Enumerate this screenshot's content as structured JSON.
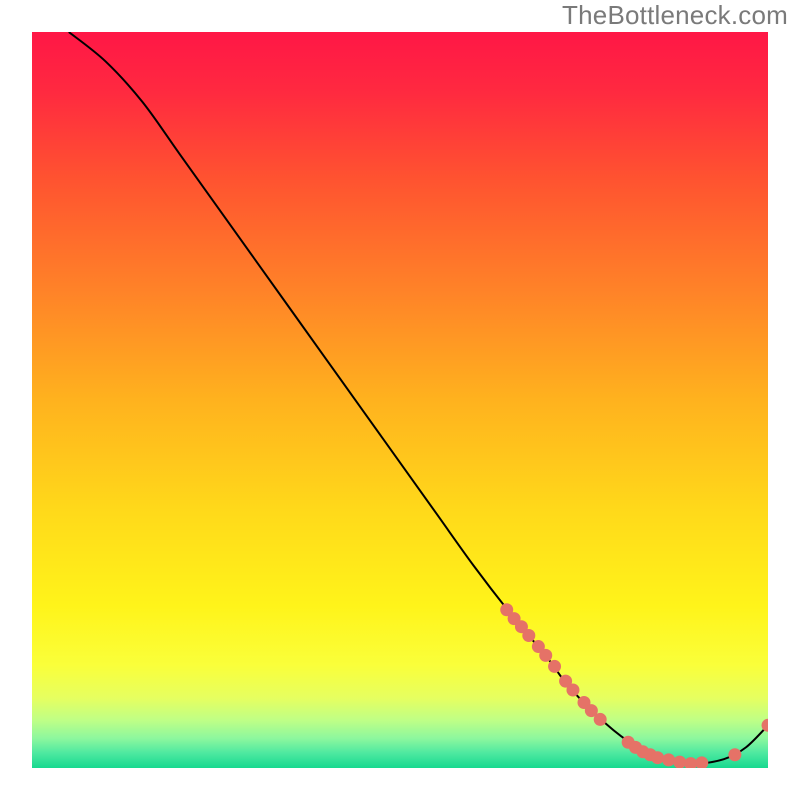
{
  "watermark": "TheBottleneck.com",
  "chart_data": {
    "type": "line",
    "title": "",
    "xlabel": "",
    "ylabel": "",
    "xlim": [
      0,
      100
    ],
    "ylim": [
      0,
      100
    ],
    "grid": false,
    "legend": false,
    "gradient_stops": [
      {
        "offset": 0.0,
        "color": "#ff1746"
      },
      {
        "offset": 0.08,
        "color": "#ff2940"
      },
      {
        "offset": 0.2,
        "color": "#ff5330"
      },
      {
        "offset": 0.35,
        "color": "#ff8228"
      },
      {
        "offset": 0.5,
        "color": "#ffb21e"
      },
      {
        "offset": 0.65,
        "color": "#ffd91a"
      },
      {
        "offset": 0.78,
        "color": "#fff41a"
      },
      {
        "offset": 0.86,
        "color": "#faff3a"
      },
      {
        "offset": 0.905,
        "color": "#e6ff60"
      },
      {
        "offset": 0.935,
        "color": "#bfff86"
      },
      {
        "offset": 0.96,
        "color": "#8cf79e"
      },
      {
        "offset": 0.98,
        "color": "#4de8a0"
      },
      {
        "offset": 1.0,
        "color": "#17d98f"
      }
    ],
    "curve": {
      "comment": "Main black curve; y is approximate distance-from-optimal metric (100=worst, 0=best)",
      "x": [
        5,
        10,
        15,
        20,
        25,
        30,
        35,
        40,
        45,
        50,
        55,
        60,
        65,
        70,
        73,
        78,
        82,
        86,
        90,
        94,
        97,
        100
      ],
      "y": [
        100,
        96,
        90.5,
        83.5,
        76.5,
        69.5,
        62.5,
        55.5,
        48.5,
        41.5,
        34.5,
        27.5,
        21.0,
        15.0,
        11.0,
        6.0,
        3.0,
        1.2,
        0.6,
        1.2,
        2.8,
        5.8
      ]
    },
    "markers": {
      "comment": "Salmon dots overlaid on the curve (right-hand cluster)",
      "color": "#e57267",
      "points": [
        {
          "x": 64.5,
          "y": 21.5
        },
        {
          "x": 65.5,
          "y": 20.3
        },
        {
          "x": 66.5,
          "y": 19.2
        },
        {
          "x": 67.5,
          "y": 18.0
        },
        {
          "x": 68.8,
          "y": 16.5
        },
        {
          "x": 69.8,
          "y": 15.3
        },
        {
          "x": 71.0,
          "y": 13.8
        },
        {
          "x": 72.5,
          "y": 11.8
        },
        {
          "x": 73.5,
          "y": 10.6
        },
        {
          "x": 75.0,
          "y": 8.9
        },
        {
          "x": 76.0,
          "y": 7.8
        },
        {
          "x": 77.2,
          "y": 6.6
        },
        {
          "x": 81.0,
          "y": 3.5
        },
        {
          "x": 82.0,
          "y": 2.8
        },
        {
          "x": 83.0,
          "y": 2.2
        },
        {
          "x": 84.0,
          "y": 1.8
        },
        {
          "x": 85.0,
          "y": 1.4
        },
        {
          "x": 86.5,
          "y": 1.1
        },
        {
          "x": 88.0,
          "y": 0.8
        },
        {
          "x": 89.5,
          "y": 0.6
        },
        {
          "x": 91.0,
          "y": 0.7
        },
        {
          "x": 95.5,
          "y": 1.8
        },
        {
          "x": 100.0,
          "y": 5.8
        }
      ]
    }
  }
}
